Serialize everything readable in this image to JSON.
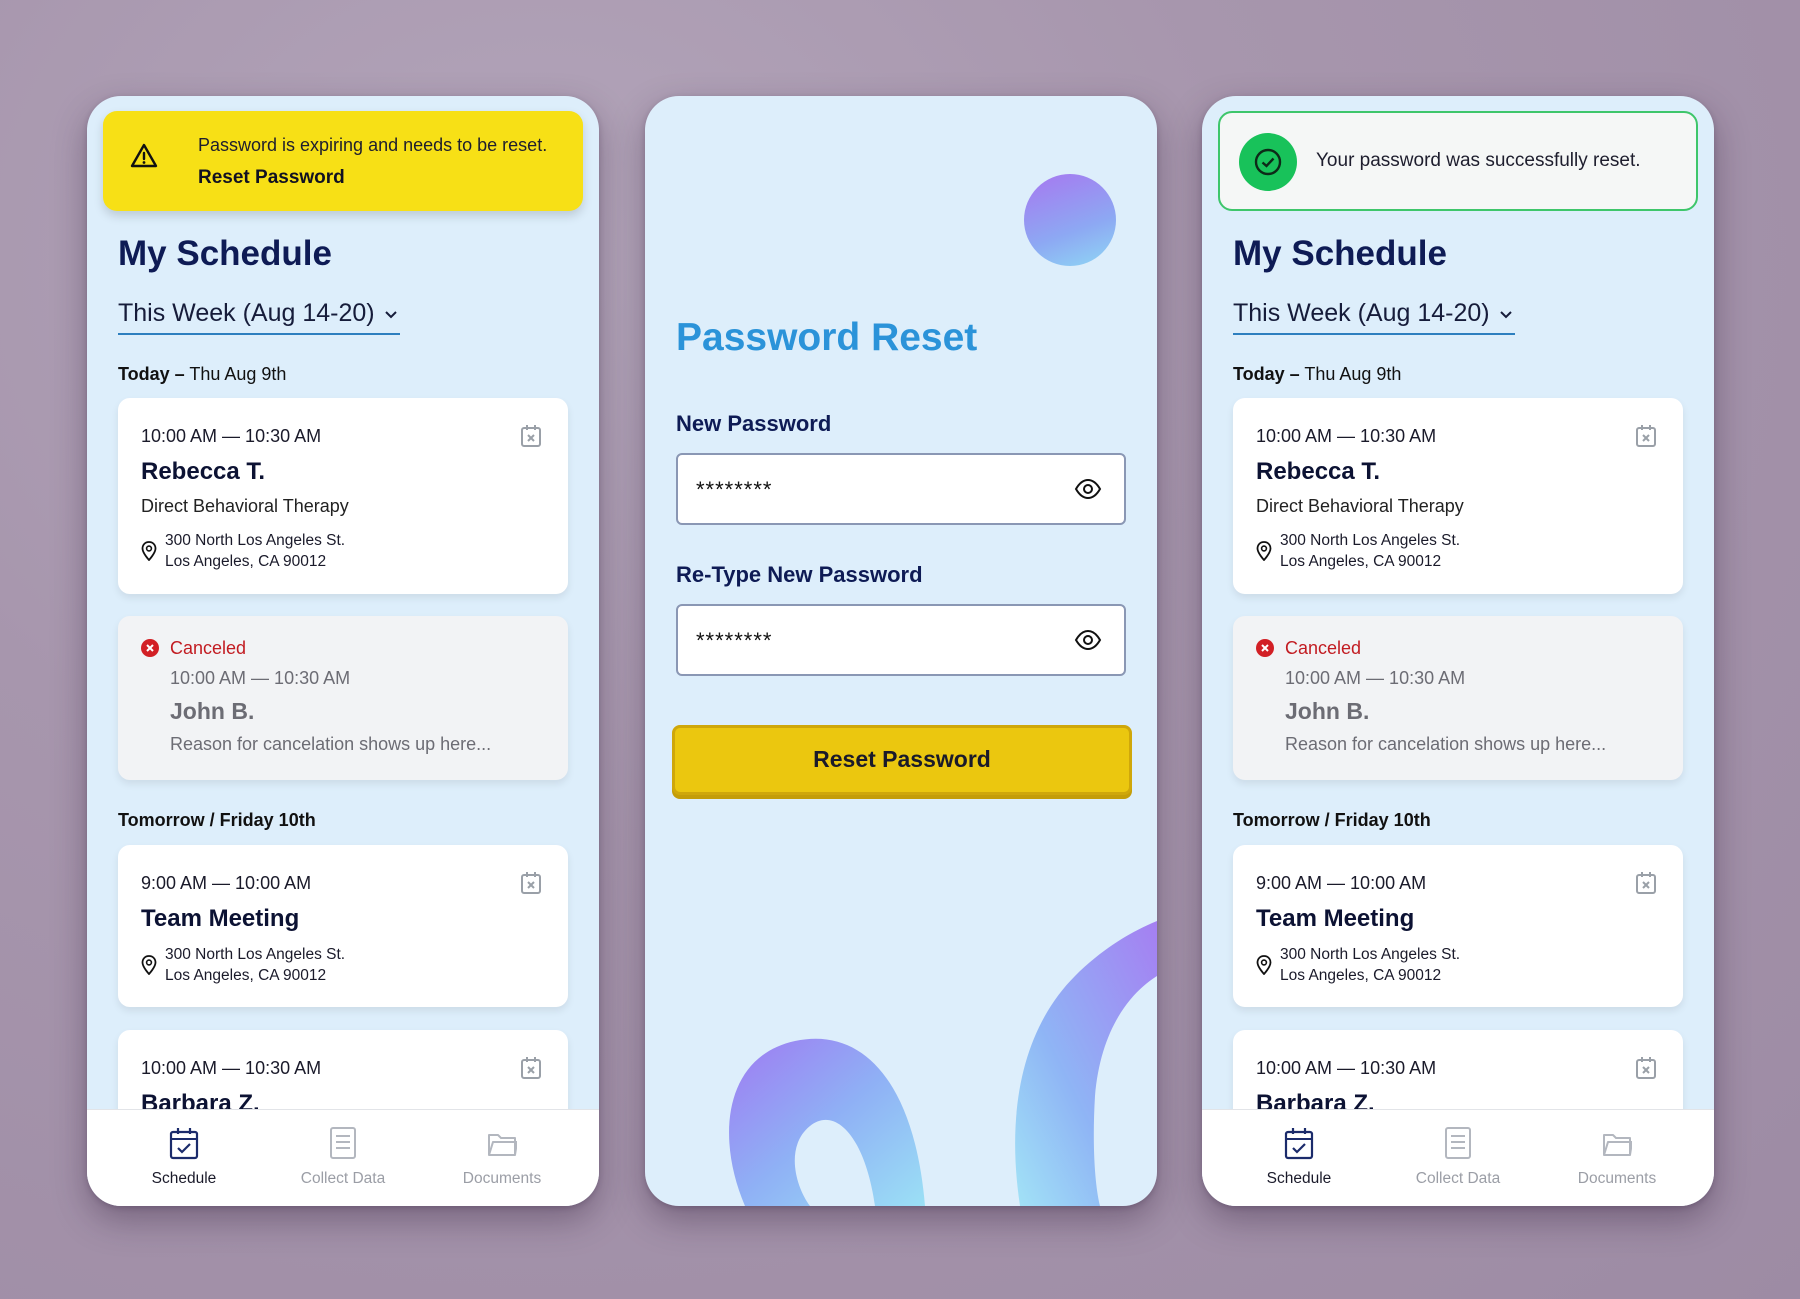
{
  "schedule_screen": {
    "title": "My Schedule",
    "week_select": "This Week (Aug 14-20)",
    "today_prefix": "Today –",
    "today_date": " Thu Aug 9th",
    "tomorrow_heading": "Tomorrow / Friday 10th",
    "appointments_today": [
      {
        "time": "10:00 AM  —  10:30 AM",
        "name": "Rebecca T.",
        "service": "Direct Behavioral Therapy",
        "address_line1": "300 North Los Angeles St.",
        "address_line2": "Los Angeles, CA 90012"
      }
    ],
    "canceled_appointment": {
      "status": "Canceled",
      "time": "10:00 AM  —  10:30 AM",
      "name": "John B.",
      "reason": "Reason for cancelation shows up here..."
    },
    "appointments_tomorrow": [
      {
        "time": "9:00 AM  —  10:00 AM",
        "name": "Team Meeting",
        "address_line1": "300 North Los Angeles St.",
        "address_line2": "Los Angeles, CA 90012"
      },
      {
        "time": "10:00 AM  —  10:30 AM",
        "name": "Barbara Z."
      }
    ],
    "tabs": [
      {
        "label": "Schedule",
        "icon": "calendar-check-icon",
        "active": true
      },
      {
        "label": "Collect Data",
        "icon": "document-icon",
        "active": false
      },
      {
        "label": "Documents",
        "icon": "folder-icon",
        "active": false
      }
    ]
  },
  "warning_banner": {
    "message": "Password is expiring and needs to be reset.",
    "link": "Reset Password",
    "icon": "warning-triangle-icon",
    "color": "#f7e016"
  },
  "success_banner": {
    "message": "Your password was successfully reset.",
    "icon": "check-circle-icon",
    "color": "#18c25a"
  },
  "password_reset": {
    "title": "Password Reset",
    "new_password_label": "New Password",
    "new_password_value": "********",
    "retype_label": "Re-Type New Password",
    "retype_value": "********",
    "button": "Reset Password",
    "button_color": "#ebc70f",
    "title_color": "#2b93d9"
  }
}
